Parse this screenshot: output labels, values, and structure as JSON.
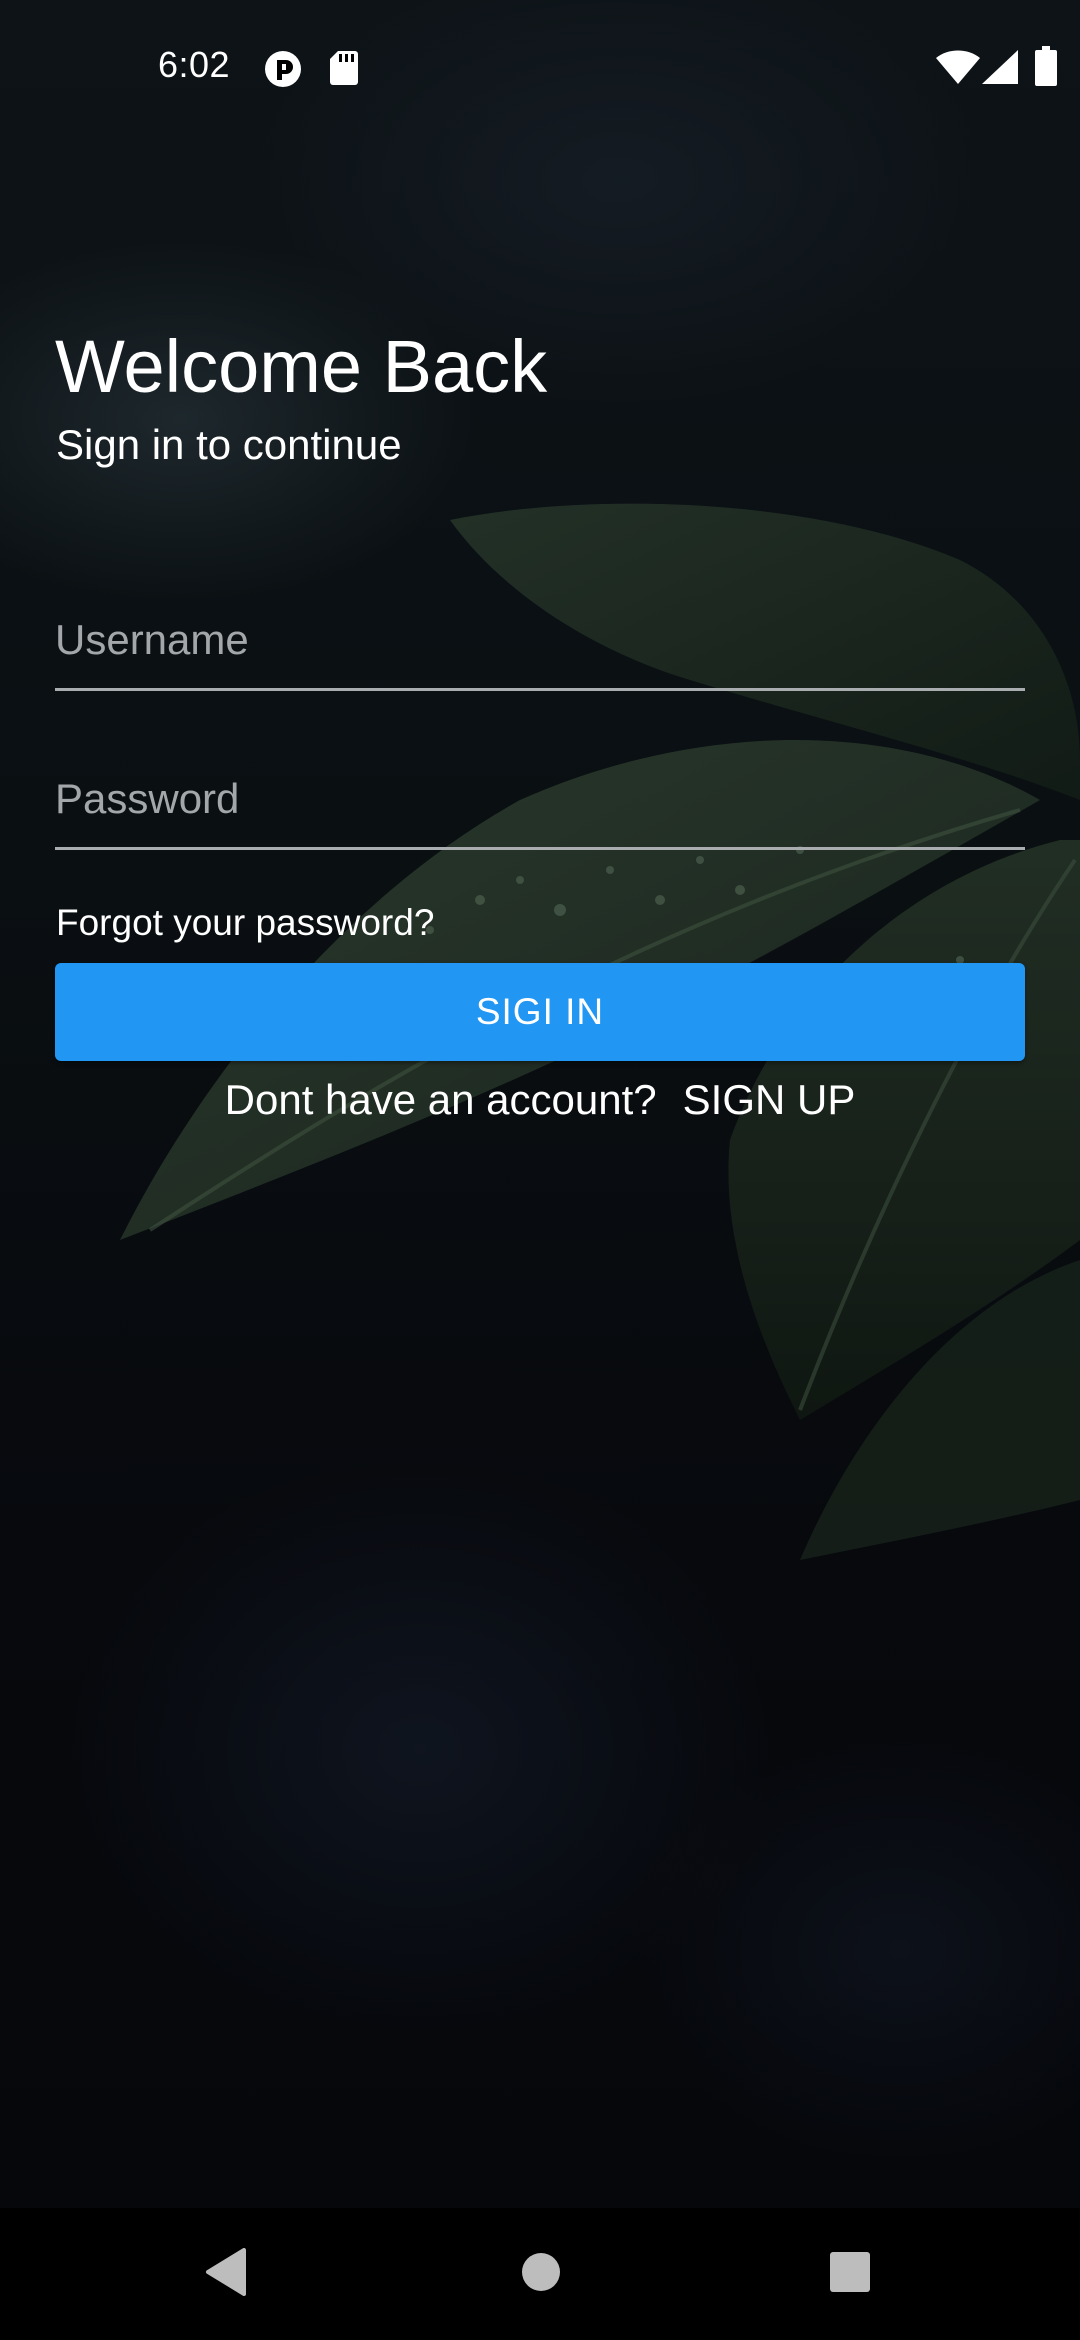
{
  "status_bar": {
    "time": "6:02",
    "icons": [
      "notification-app-icon",
      "sd-card-icon",
      "wifi-icon",
      "cell-signal-icon",
      "battery-icon"
    ]
  },
  "login": {
    "title": "Welcome Back",
    "subtitle": "Sign in to continue",
    "username_placeholder": "Username",
    "password_placeholder": "Password",
    "username_value": "",
    "password_value": "",
    "forgot_label": "Forgot your password?",
    "signin_label": "SIGI IN",
    "signup_prompt": "Dont have an account?",
    "signup_label": "SIGN UP"
  },
  "nav_bar": {
    "icons": [
      "back-icon",
      "home-icon",
      "recents-icon"
    ]
  },
  "colors": {
    "accent": "#2196f3",
    "background": "#07090d",
    "underline": "#a9adb0",
    "placeholder": "#a3a7aa"
  }
}
